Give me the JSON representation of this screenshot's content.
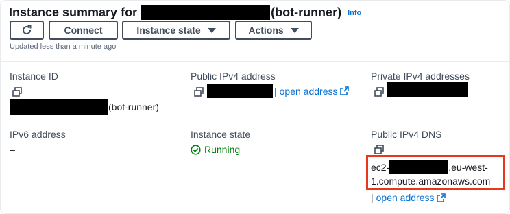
{
  "header": {
    "title_prefix": "Instance summary for",
    "title_suffix": "(bot-runner)",
    "info_label": "Info",
    "updated_text": "Updated less than a minute ago"
  },
  "toolbar": {
    "refresh_icon": "refresh-icon",
    "connect_label": "Connect",
    "instance_state_label": "Instance state",
    "actions_label": "Actions"
  },
  "fields": {
    "instance_id": {
      "label": "Instance ID",
      "value_suffix": "(bot-runner)"
    },
    "public_ipv4": {
      "label": "Public IPv4 address",
      "link_label": "open address",
      "separator": "|"
    },
    "private_ipv4": {
      "label": "Private IPv4 addresses"
    },
    "ipv6": {
      "label": "IPv6 address",
      "value": "–"
    },
    "instance_state": {
      "label": "Instance state",
      "value": "Running",
      "status_color": "#037f0c"
    },
    "public_dns": {
      "label": "Public IPv4 DNS",
      "value_prefix": "ec2-",
      "value_suffix": ".eu-west-",
      "value_line2": "1.compute.amazonaws.com",
      "link_label": "open address",
      "separator": "|"
    }
  },
  "colors": {
    "link": "#0972d3",
    "highlight": "#e8381c",
    "button_border": "#414d5c"
  }
}
